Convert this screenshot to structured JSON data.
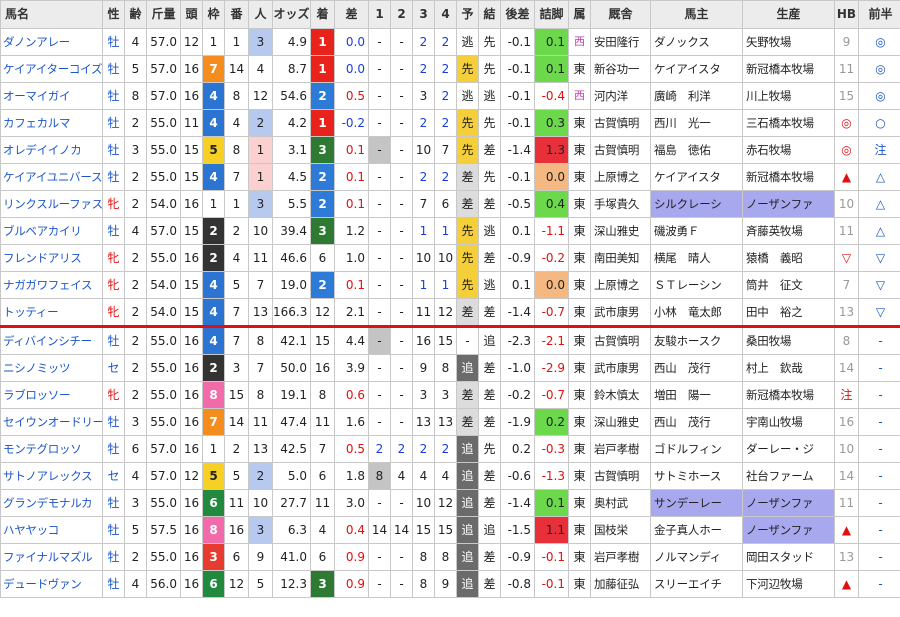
{
  "headers": [
    "馬名",
    "性",
    "齢",
    "斤量",
    "頭",
    "枠",
    "番",
    "人",
    "オッズ",
    "着",
    "差",
    "1",
    "2",
    "3",
    "4",
    "予",
    "結",
    "後差",
    "詰脚",
    "属",
    "厩舎",
    "馬主",
    "生産",
    "HB",
    "前半"
  ],
  "colors": {
    "waku1": "#ffffff",
    "waku2": "#333333",
    "waku3": "#e63c2f",
    "waku4": "#2c74d2",
    "waku5": "#f6d024",
    "waku6": "#218a3f",
    "waku7": "#f58d1e",
    "waku8": "#f36aaa",
    "separator": "#e01010"
  },
  "rows": [
    {
      "name": "ダノンアレー",
      "sex": "牡",
      "age": "4",
      "kin": "57.0",
      "to": "12",
      "waku": "1",
      "ban": "1",
      "nin": "3",
      "odds": "4.9",
      "chaku": "1",
      "sa": "0.0",
      "c1": "-",
      "c2": "-",
      "c3": "2",
      "c4": "2",
      "yo": "逃",
      "ke": "先",
      "ato": "-0.1",
      "tsume": "0.1",
      "zoku": "西",
      "kyu": "安田隆行",
      "owner": "ダノックス",
      "prod": "矢野牧場",
      "hb": "9",
      "zen": "◎"
    },
    {
      "name": "ケイアイターコイズ",
      "sex": "牡",
      "age": "5",
      "kin": "57.0",
      "to": "16",
      "waku": "7",
      "ban": "14",
      "nin": "4",
      "odds": "8.7",
      "chaku": "1",
      "sa": "0.0",
      "c1": "-",
      "c2": "-",
      "c3": "2",
      "c4": "2",
      "yo": "先",
      "ke": "先",
      "ato": "-0.1",
      "tsume": "0.1",
      "zoku": "東",
      "kyu": "新谷功一",
      "owner": "ケイアイスタ",
      "prod": "新冠橋本牧場",
      "hb": "11",
      "zen": "◎"
    },
    {
      "name": "オーマイガイ",
      "sex": "牡",
      "age": "8",
      "kin": "57.0",
      "to": "16",
      "waku": "4",
      "ban": "8",
      "nin": "12",
      "odds": "54.6",
      "chaku": "2",
      "sa": "0.5",
      "c1": "-",
      "c2": "-",
      "c3": "3",
      "c4": "2",
      "yo": "逃",
      "ke": "逃",
      "ato": "-0.1",
      "tsume": "-0.4",
      "zoku": "西",
      "kyu": "河内洋",
      "owner": "廣崎　利洋",
      "prod": "川上牧場",
      "hb": "15",
      "zen": "◎"
    },
    {
      "name": "カフェカルマ",
      "sex": "牡",
      "age": "2",
      "kin": "55.0",
      "to": "11",
      "waku": "4",
      "ban": "4",
      "nin": "2",
      "odds": "4.2",
      "chaku": "1",
      "sa": "-0.2",
      "c1": "-",
      "c2": "-",
      "c3": "2",
      "c4": "2",
      "yo": "先",
      "ke": "先",
      "ato": "-0.1",
      "tsume": "0.3",
      "zoku": "東",
      "kyu": "古賀慎明",
      "owner": "西川　光一",
      "prod": "三石橋本牧場",
      "hb": "◎",
      "zen": "○"
    },
    {
      "name": "オレデイイノカ",
      "sex": "牡",
      "age": "3",
      "kin": "55.0",
      "to": "15",
      "waku": "5",
      "ban": "8",
      "nin": "1",
      "odds": "3.1",
      "chaku": "3",
      "sa": "0.1",
      "c1": "-",
      "c2": "-",
      "c3": "10",
      "c4": "7",
      "yo": "先",
      "ke": "差",
      "ato": "-1.4",
      "tsume": "1.3",
      "zoku": "東",
      "kyu": "古賀慎明",
      "owner": "福島　徳佑",
      "prod": "赤石牧場",
      "hb": "◎",
      "zen": "注"
    },
    {
      "name": "ケイアイユニバース",
      "sex": "牡",
      "age": "2",
      "kin": "55.0",
      "to": "15",
      "waku": "4",
      "ban": "7",
      "nin": "1",
      "odds": "4.5",
      "chaku": "2",
      "sa": "0.1",
      "c1": "-",
      "c2": "-",
      "c3": "2",
      "c4": "2",
      "yo": "差",
      "ke": "先",
      "ato": "-0.1",
      "tsume": "0.0",
      "zoku": "東",
      "kyu": "上原博之",
      "owner": "ケイアイスタ",
      "prod": "新冠橋本牧場",
      "hb": "▲",
      "zen": "△"
    },
    {
      "name": "リンクスルーファス",
      "sex": "牝",
      "age": "2",
      "kin": "54.0",
      "to": "16",
      "waku": "1",
      "ban": "1",
      "nin": "3",
      "odds": "5.5",
      "chaku": "2",
      "sa": "0.1",
      "c1": "-",
      "c2": "-",
      "c3": "7",
      "c4": "6",
      "yo": "差",
      "ke": "差",
      "ato": "-0.5",
      "tsume": "0.4",
      "zoku": "東",
      "kyu": "手塚貴久",
      "owner": "シルクレーシ",
      "prod": "ノーザンファ",
      "hb": "10",
      "zen": "△"
    },
    {
      "name": "ブルベアカイリ",
      "sex": "牡",
      "age": "4",
      "kin": "57.0",
      "to": "15",
      "waku": "2",
      "ban": "2",
      "nin": "10",
      "odds": "39.4",
      "chaku": "3",
      "sa": "1.2",
      "c1": "-",
      "c2": "-",
      "c3": "1",
      "c4": "1",
      "yo": "先",
      "ke": "逃",
      "ato": "0.1",
      "tsume": "-1.1",
      "zoku": "東",
      "kyu": "深山雅史",
      "owner": "磯波勇Ｆ",
      "prod": "斉藤英牧場",
      "hb": "11",
      "zen": "△"
    },
    {
      "name": "フレンドアリス",
      "sex": "牝",
      "age": "2",
      "kin": "55.0",
      "to": "16",
      "waku": "2",
      "ban": "4",
      "nin": "11",
      "odds": "46.6",
      "chaku": "6",
      "sa": "1.0",
      "c1": "-",
      "c2": "-",
      "c3": "10",
      "c4": "10",
      "yo": "先",
      "ke": "差",
      "ato": "-0.9",
      "tsume": "-0.2",
      "zoku": "東",
      "kyu": "南田美知",
      "owner": "横尾　晴人",
      "prod": "猿橋　義昭",
      "hb": "▽",
      "zen": "▽"
    },
    {
      "name": "ナガガワフェイス",
      "sex": "牝",
      "age": "2",
      "kin": "54.0",
      "to": "15",
      "waku": "4",
      "ban": "5",
      "nin": "7",
      "odds": "19.0",
      "chaku": "2",
      "sa": "0.1",
      "c1": "-",
      "c2": "-",
      "c3": "1",
      "c4": "1",
      "yo": "先",
      "ke": "逃",
      "ato": "0.1",
      "tsume": "0.0",
      "zoku": "東",
      "kyu": "上原博之",
      "owner": "ＳＴレーシン",
      "prod": "筒井　征文",
      "hb": "7",
      "zen": "▽"
    },
    {
      "name": "トッティー",
      "sex": "牝",
      "age": "2",
      "kin": "54.0",
      "to": "15",
      "waku": "4",
      "ban": "7",
      "nin": "13",
      "odds": "166.3",
      "chaku": "12",
      "sa": "2.1",
      "c1": "-",
      "c2": "-",
      "c3": "11",
      "c4": "12",
      "yo": "差",
      "ke": "差",
      "ato": "-1.4",
      "tsume": "-0.7",
      "zoku": "東",
      "kyu": "武市康男",
      "owner": "小林　竜太郎",
      "prod": "田中　裕之",
      "hb": "13",
      "zen": "▽"
    },
    {
      "name": "ディバインシチー",
      "sex": "牡",
      "age": "2",
      "kin": "55.0",
      "to": "16",
      "waku": "4",
      "ban": "7",
      "nin": "8",
      "odds": "42.1",
      "chaku": "15",
      "sa": "4.4",
      "c1": "-",
      "c2": "-",
      "c3": "16",
      "c4": "15",
      "yo": "-",
      "ke": "追",
      "ato": "-2.3",
      "tsume": "-2.1",
      "zoku": "東",
      "kyu": "古賀慎明",
      "owner": "友駿ホースク",
      "prod": "桑田牧場",
      "hb": "8",
      "zen": "-"
    },
    {
      "name": "ニシノミッツ",
      "sex": "セ",
      "age": "2",
      "kin": "55.0",
      "to": "16",
      "waku": "2",
      "ban": "3",
      "nin": "7",
      "odds": "50.0",
      "chaku": "16",
      "sa": "3.9",
      "c1": "-",
      "c2": "-",
      "c3": "9",
      "c4": "8",
      "yo": "追",
      "ke": "差",
      "ato": "-1.0",
      "tsume": "-2.9",
      "zoku": "東",
      "kyu": "武市康男",
      "owner": "西山　茂行",
      "prod": "村上　欽哉",
      "hb": "14",
      "zen": "-"
    },
    {
      "name": "ラブロッソー",
      "sex": "牝",
      "age": "2",
      "kin": "55.0",
      "to": "16",
      "waku": "8",
      "ban": "15",
      "nin": "8",
      "odds": "19.1",
      "chaku": "8",
      "sa": "0.6",
      "c1": "-",
      "c2": "-",
      "c3": "3",
      "c4": "3",
      "yo": "差",
      "ke": "差",
      "ato": "-0.2",
      "tsume": "-0.7",
      "zoku": "東",
      "kyu": "鈴木慎太",
      "owner": "増田　陽一",
      "prod": "新冠橋本牧場",
      "hb": "注",
      "zen": "-"
    },
    {
      "name": "セイウンオードリー",
      "sex": "牡",
      "age": "3",
      "kin": "55.0",
      "to": "16",
      "waku": "7",
      "ban": "14",
      "nin": "11",
      "odds": "47.4",
      "chaku": "11",
      "sa": "1.6",
      "c1": "-",
      "c2": "-",
      "c3": "13",
      "c4": "13",
      "yo": "差",
      "ke": "差",
      "ato": "-1.9",
      "tsume": "0.2",
      "zoku": "東",
      "kyu": "深山雅史",
      "owner": "西山　茂行",
      "prod": "宇南山牧場",
      "hb": "16",
      "zen": "-"
    },
    {
      "name": "モンテグロッソ",
      "sex": "牡",
      "age": "6",
      "kin": "57.0",
      "to": "16",
      "waku": "1",
      "ban": "2",
      "nin": "13",
      "odds": "42.5",
      "chaku": "7",
      "sa": "0.5",
      "c1": "2",
      "c2": "2",
      "c3": "2",
      "c4": "2",
      "yo": "追",
      "ke": "先",
      "ato": "0.2",
      "tsume": "-0.3",
      "zoku": "東",
      "kyu": "岩戸孝樹",
      "owner": "ゴドルフィン",
      "prod": "ダーレー・ジ",
      "hb": "10",
      "zen": "-"
    },
    {
      "name": "サトノアレックス",
      "sex": "セ",
      "age": "4",
      "kin": "57.0",
      "to": "12",
      "waku": "5",
      "ban": "5",
      "nin": "2",
      "odds": "5.0",
      "chaku": "6",
      "sa": "1.8",
      "c1": "8",
      "c2": "4",
      "c3": "4",
      "c4": "4",
      "yo": "追",
      "ke": "差",
      "ato": "-0.6",
      "tsume": "-1.3",
      "zoku": "東",
      "kyu": "古賀慎明",
      "owner": "サトミホース",
      "prod": "社台ファーム",
      "hb": "14",
      "zen": "-"
    },
    {
      "name": "グランデモナルカ",
      "sex": "牡",
      "age": "3",
      "kin": "55.0",
      "to": "16",
      "waku": "6",
      "ban": "11",
      "nin": "10",
      "odds": "27.7",
      "chaku": "11",
      "sa": "3.0",
      "c1": "-",
      "c2": "-",
      "c3": "10",
      "c4": "12",
      "yo": "追",
      "ke": "差",
      "ato": "-1.4",
      "tsume": "0.1",
      "zoku": "東",
      "kyu": "奥村武",
      "owner": "サンデーレー",
      "prod": "ノーザンファ",
      "hb": "11",
      "zen": "-"
    },
    {
      "name": "ハヤヤッコ",
      "sex": "牡",
      "age": "5",
      "kin": "57.5",
      "to": "16",
      "waku": "8",
      "ban": "16",
      "nin": "3",
      "odds": "6.3",
      "chaku": "4",
      "sa": "0.4",
      "c1": "14",
      "c2": "14",
      "c3": "15",
      "c4": "15",
      "yo": "追",
      "ke": "追",
      "ato": "-1.5",
      "tsume": "1.1",
      "zoku": "東",
      "kyu": "国枝栄",
      "owner": "金子真人ホー",
      "prod": "ノーザンファ",
      "hb": "▲",
      "zen": "-"
    },
    {
      "name": "ファイナルマズル",
      "sex": "牡",
      "age": "2",
      "kin": "55.0",
      "to": "16",
      "waku": "3",
      "ban": "6",
      "nin": "9",
      "odds": "41.0",
      "chaku": "6",
      "sa": "0.9",
      "c1": "-",
      "c2": "-",
      "c3": "8",
      "c4": "8",
      "yo": "追",
      "ke": "差",
      "ato": "-0.9",
      "tsume": "-0.1",
      "zoku": "東",
      "kyu": "岩戸孝樹",
      "owner": "ノルマンディ",
      "prod": "岡田スタッド",
      "hb": "13",
      "zen": "-"
    },
    {
      "name": "デュードヴァン",
      "sex": "牡",
      "age": "4",
      "kin": "56.0",
      "to": "16",
      "waku": "6",
      "ban": "12",
      "nin": "5",
      "odds": "12.3",
      "chaku": "3",
      "sa": "0.9",
      "c1": "-",
      "c2": "-",
      "c3": "8",
      "c4": "9",
      "yo": "追",
      "ke": "差",
      "ato": "-0.8",
      "tsume": "-0.1",
      "zoku": "東",
      "kyu": "加藤征弘",
      "owner": "スリーエイチ",
      "prod": "下河辺牧場",
      "hb": "▲",
      "zen": "-"
    }
  ]
}
